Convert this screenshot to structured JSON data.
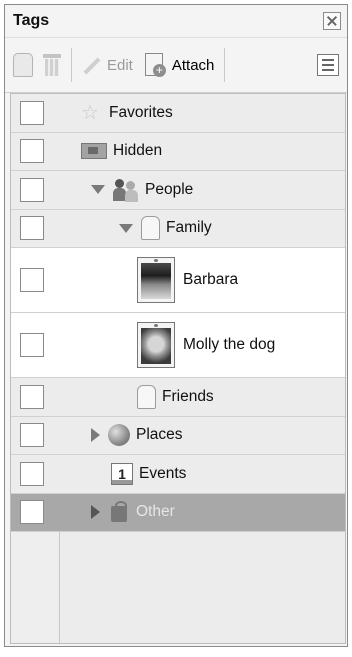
{
  "panel": {
    "title": "Tags"
  },
  "toolbar": {
    "edit_label": "Edit",
    "attach_label": "Attach"
  },
  "tags": [
    {
      "label": "Favorites",
      "icon": "star-icon",
      "indent": 0
    },
    {
      "label": "Hidden",
      "icon": "hidden-icon",
      "indent": 0
    },
    {
      "label": "People",
      "icon": "people-icon",
      "indent": 0,
      "expanded": true
    },
    {
      "label": "Family",
      "icon": "tag-icon",
      "indent": 1,
      "expanded": true
    },
    {
      "label": "Barbara",
      "icon": "photo-tag-icon",
      "indent": 2
    },
    {
      "label": "Molly the dog",
      "icon": "photo-tag-icon",
      "indent": 2
    },
    {
      "label": "Friends",
      "icon": "tag-icon",
      "indent": 2
    },
    {
      "label": "Places",
      "icon": "globe-icon",
      "indent": 0,
      "expanded": false
    },
    {
      "label": "Events",
      "icon": "calendar-icon",
      "indent": 0
    },
    {
      "label": "Other",
      "icon": "other-icon",
      "indent": 0,
      "expanded": false,
      "selected": true
    }
  ]
}
